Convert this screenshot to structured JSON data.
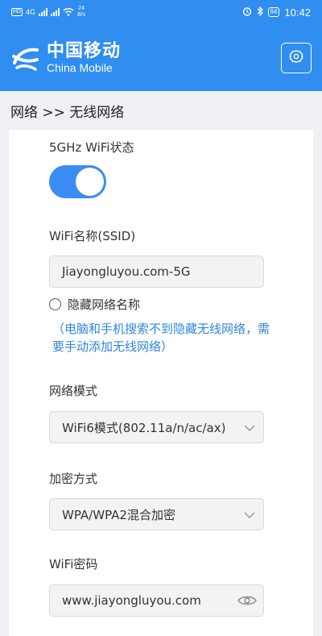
{
  "status_bar": {
    "hd_label": "HD",
    "network_type": "4G",
    "speed_value": "24",
    "speed_unit": "B/s",
    "battery": "94",
    "time": "10:42"
  },
  "header": {
    "brand_cn": "中国移动",
    "brand_en": "China Mobile"
  },
  "breadcrumb": {
    "text": "网络 >> 无线网络"
  },
  "form": {
    "wifi_status_label": "5GHz WiFi状态",
    "wifi_status_on": true,
    "ssid_label": "WiFi名称(SSID)",
    "ssid_value": "Jiayongluyou.com-5G",
    "hide_ssid_label": "隐藏网络名称",
    "hide_ssid_checked": false,
    "hint_text": "（电脑和手机搜索不到隐藏无线网络，需要手动添加无线网络）",
    "mode_label": "网络模式",
    "mode_value": "WiFi6模式(802.11a/n/ac/ax)",
    "encryption_label": "加密方式",
    "encryption_value": "WPA/WPA2混合加密",
    "password_label": "WiFi密码",
    "password_value": "www.jiayongluyou.com"
  },
  "colors": {
    "brand_blue": "#2f8ef0",
    "toggle_on": "#3a8cf2",
    "hint_blue": "#2f87dc"
  }
}
